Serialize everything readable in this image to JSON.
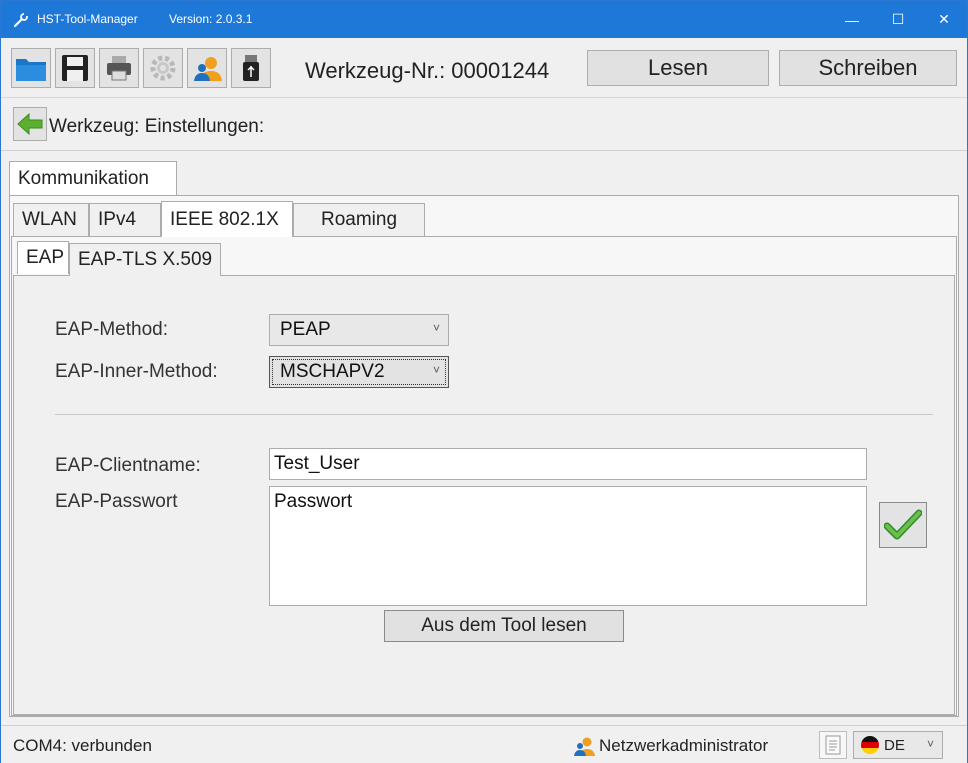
{
  "titlebar": {
    "title": "HST-Tool-Manager",
    "version": "Version: 2.0.3.1",
    "minimize": "—",
    "maximize": "☐",
    "close": "✕"
  },
  "toolbar": {
    "icons": [
      "folder-icon",
      "save-icon",
      "print-icon",
      "settings-icon",
      "user-icon",
      "usb-icon"
    ],
    "tool_number": "Werkzeug-Nr.: 00001244",
    "read_label": "Lesen",
    "write_label": "Schreiben"
  },
  "breadcrumb": {
    "label": "Werkzeug: Einstellungen:"
  },
  "tabs_top": [
    {
      "label": "Kommunikation",
      "active": true
    }
  ],
  "tabs_comm": [
    {
      "label": "WLAN",
      "active": false
    },
    {
      "label": "IPv4",
      "active": false
    },
    {
      "label": "IEEE 802.1X",
      "active": true
    },
    {
      "label": "Roaming",
      "active": false
    }
  ],
  "tabs_eap": [
    {
      "label": "EAP",
      "active": true
    },
    {
      "label": "EAP-TLS X.509",
      "active": false
    }
  ],
  "form": {
    "eap_method_label": "EAP-Method:",
    "eap_method_value": "PEAP",
    "eap_inner_label": "EAP-Inner-Method:",
    "eap_inner_value": "MSCHAPV2",
    "client_label": "EAP-Clientname:",
    "client_value": "Test_User",
    "password_label": "EAP-Passwort",
    "password_value": "Passwort",
    "read_from_tool": "Aus dem Tool lesen"
  },
  "statusbar": {
    "connection": "COM4: verbunden",
    "role": "Netzwerkadministrator",
    "language": "DE"
  },
  "colors": {
    "titlebar": "#1e78d7",
    "accent_green": "#4caf50",
    "background": "#f0f0f0"
  }
}
